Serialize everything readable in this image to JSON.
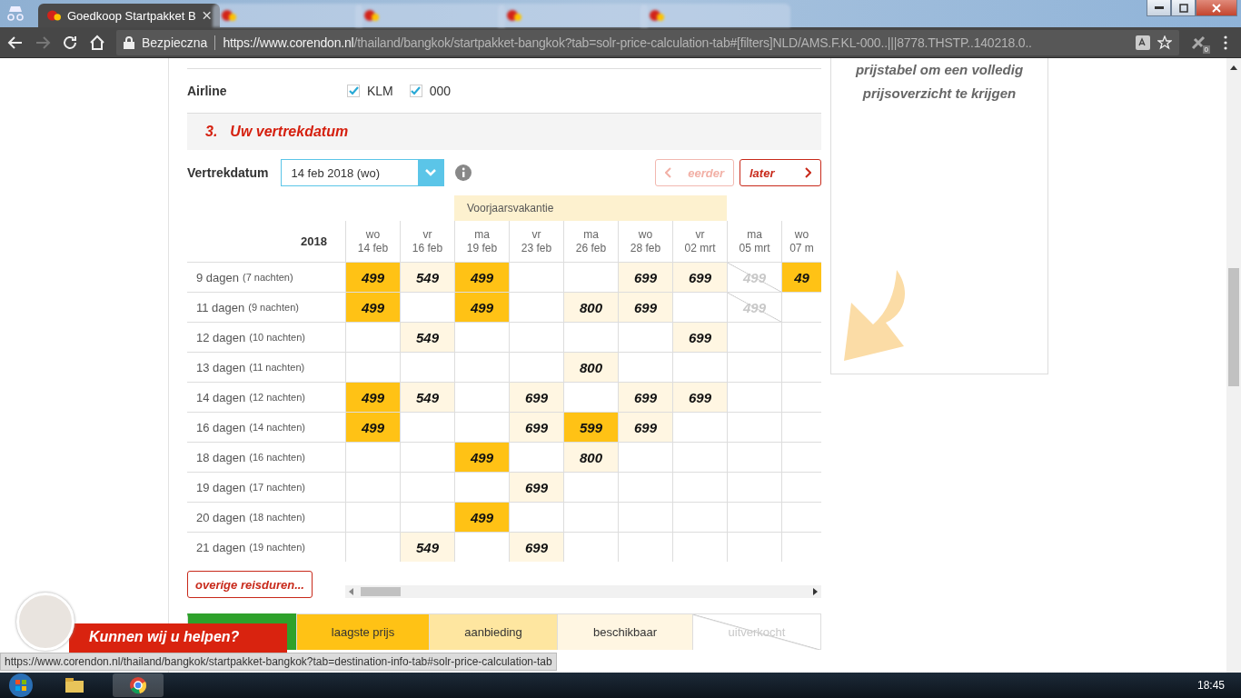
{
  "browser": {
    "tabs": [
      {
        "title": "Goedkoop Startpakket B",
        "selected": true
      },
      {
        "selected": false
      },
      {
        "selected": false
      },
      {
        "selected": false
      },
      {
        "selected": false
      }
    ],
    "security": "Bezpieczna",
    "url": {
      "host": "https://www.corendon.nl",
      "path": "/thailand/bangkok/startpakket-bangkok?tab=solr-price-calculation-tab#[filters]NLD/AMS.F.KL-000..|||8778.THSTP..140218.0.."
    },
    "extension_badge": "0"
  },
  "airline": {
    "label": "Airline",
    "options": [
      {
        "label": "KLM",
        "checked": true
      },
      {
        "label": "000",
        "checked": true
      }
    ]
  },
  "section": {
    "number": "3.",
    "title": "Uw vertrekdatum"
  },
  "departure": {
    "label": "Vertrekdatum",
    "value": "14 feb 2018 (wo)",
    "earlier": {
      "label": "eerder",
      "disabled": true
    },
    "later": {
      "label": "later",
      "disabled": false
    }
  },
  "table": {
    "year": "2018",
    "holiday": "Voorjaarsvakantie",
    "columns": [
      {
        "weekday": "wo",
        "date": "14 feb",
        "holiday": false
      },
      {
        "weekday": "vr",
        "date": "16 feb",
        "holiday": false
      },
      {
        "weekday": "ma",
        "date": "19 feb",
        "holiday": true
      },
      {
        "weekday": "vr",
        "date": "23 feb",
        "holiday": true
      },
      {
        "weekday": "ma",
        "date": "26 feb",
        "holiday": true
      },
      {
        "weekday": "wo",
        "date": "28 feb",
        "holiday": true
      },
      {
        "weekday": "vr",
        "date": "02 mrt",
        "holiday": true
      },
      {
        "weekday": "ma",
        "date": "05 mrt",
        "holiday": false
      },
      {
        "weekday": "wo",
        "date": "07 m",
        "holiday": false
      }
    ],
    "rows": [
      {
        "days": "9 dagen",
        "nights": "(7 nachten)",
        "cells": [
          {
            "kind": "lowest",
            "price": "499"
          },
          {
            "kind": "available",
            "price": "549"
          },
          {
            "kind": "lowest",
            "price": "499"
          },
          {
            "kind": "empty"
          },
          {
            "kind": "empty"
          },
          {
            "kind": "available",
            "price": "699"
          },
          {
            "kind": "available",
            "price": "699"
          },
          {
            "kind": "soldout",
            "price": "499"
          },
          {
            "kind": "lowest",
            "price": "49"
          }
        ]
      },
      {
        "days": "11 dagen",
        "nights": "(9 nachten)",
        "cells": [
          {
            "kind": "lowest",
            "price": "499"
          },
          {
            "kind": "empty"
          },
          {
            "kind": "lowest",
            "price": "499"
          },
          {
            "kind": "empty"
          },
          {
            "kind": "available",
            "price": "800"
          },
          {
            "kind": "available",
            "price": "699"
          },
          {
            "kind": "empty"
          },
          {
            "kind": "soldout",
            "price": "499"
          },
          {
            "kind": "empty"
          }
        ]
      },
      {
        "days": "12 dagen",
        "nights": "(10 nachten)",
        "cells": [
          {
            "kind": "empty"
          },
          {
            "kind": "available",
            "price": "549"
          },
          {
            "kind": "empty"
          },
          {
            "kind": "empty"
          },
          {
            "kind": "empty"
          },
          {
            "kind": "empty"
          },
          {
            "kind": "available",
            "price": "699"
          },
          {
            "kind": "empty"
          },
          {
            "kind": "empty"
          }
        ]
      },
      {
        "days": "13 dagen",
        "nights": "(11 nachten)",
        "cells": [
          {
            "kind": "empty"
          },
          {
            "kind": "empty"
          },
          {
            "kind": "empty"
          },
          {
            "kind": "empty"
          },
          {
            "kind": "available",
            "price": "800"
          },
          {
            "kind": "empty"
          },
          {
            "kind": "empty"
          },
          {
            "kind": "empty"
          },
          {
            "kind": "empty"
          }
        ]
      },
      {
        "days": "14 dagen",
        "nights": "(12 nachten)",
        "cells": [
          {
            "kind": "lowest",
            "price": "499"
          },
          {
            "kind": "available",
            "price": "549"
          },
          {
            "kind": "empty"
          },
          {
            "kind": "available",
            "price": "699"
          },
          {
            "kind": "empty"
          },
          {
            "kind": "available",
            "price": "699"
          },
          {
            "kind": "available",
            "price": "699"
          },
          {
            "kind": "empty"
          },
          {
            "kind": "empty"
          }
        ]
      },
      {
        "days": "16 dagen",
        "nights": "(14 nachten)",
        "cells": [
          {
            "kind": "lowest",
            "price": "499"
          },
          {
            "kind": "empty"
          },
          {
            "kind": "empty"
          },
          {
            "kind": "available",
            "price": "699"
          },
          {
            "kind": "lowest",
            "price": "599"
          },
          {
            "kind": "available",
            "price": "699"
          },
          {
            "kind": "empty"
          },
          {
            "kind": "empty"
          },
          {
            "kind": "empty"
          }
        ]
      },
      {
        "days": "18 dagen",
        "nights": "(16 nachten)",
        "cells": [
          {
            "kind": "empty"
          },
          {
            "kind": "empty"
          },
          {
            "kind": "lowest",
            "price": "499"
          },
          {
            "kind": "empty"
          },
          {
            "kind": "available",
            "price": "800"
          },
          {
            "kind": "empty"
          },
          {
            "kind": "empty"
          },
          {
            "kind": "empty"
          },
          {
            "kind": "empty"
          }
        ]
      },
      {
        "days": "19 dagen",
        "nights": "(17 nachten)",
        "cells": [
          {
            "kind": "empty"
          },
          {
            "kind": "empty"
          },
          {
            "kind": "empty"
          },
          {
            "kind": "available",
            "price": "699"
          },
          {
            "kind": "empty"
          },
          {
            "kind": "empty"
          },
          {
            "kind": "empty"
          },
          {
            "kind": "empty"
          },
          {
            "kind": "empty"
          }
        ]
      },
      {
        "days": "20 dagen",
        "nights": "(18 nachten)",
        "cells": [
          {
            "kind": "empty"
          },
          {
            "kind": "empty"
          },
          {
            "kind": "lowest",
            "price": "499"
          },
          {
            "kind": "empty"
          },
          {
            "kind": "empty"
          },
          {
            "kind": "empty"
          },
          {
            "kind": "empty"
          },
          {
            "kind": "empty"
          },
          {
            "kind": "empty"
          }
        ]
      },
      {
        "days": "21 dagen",
        "nights": "(19 nachten)",
        "cells": [
          {
            "kind": "empty"
          },
          {
            "kind": "available",
            "price": "549"
          },
          {
            "kind": "empty"
          },
          {
            "kind": "available",
            "price": "699"
          },
          {
            "kind": "empty"
          },
          {
            "kind": "empty"
          },
          {
            "kind": "empty"
          },
          {
            "kind": "empty"
          },
          {
            "kind": "empty"
          }
        ]
      }
    ]
  },
  "more_durations": "overige reisduren...",
  "legend": [
    {
      "kind": "selected"
    },
    {
      "kind": "lowest",
      "label": "laagste prijs"
    },
    {
      "kind": "offer",
      "label": "aanbieding"
    },
    {
      "kind": "available",
      "label": "beschikbaar"
    },
    {
      "kind": "soldout",
      "label": "uitverkocht"
    }
  ],
  "side_note": "prijstabel om een volledig prijsoverzicht te krijgen",
  "chat": {
    "label": "Kunnen wij u helpen?"
  },
  "status_url": "https://www.corendon.nl/thailand/bangkok/startpakket-bangkok?tab=destination-info-tab#solr-price-calculation-tab",
  "taskbar": {
    "clock": "18:45"
  }
}
